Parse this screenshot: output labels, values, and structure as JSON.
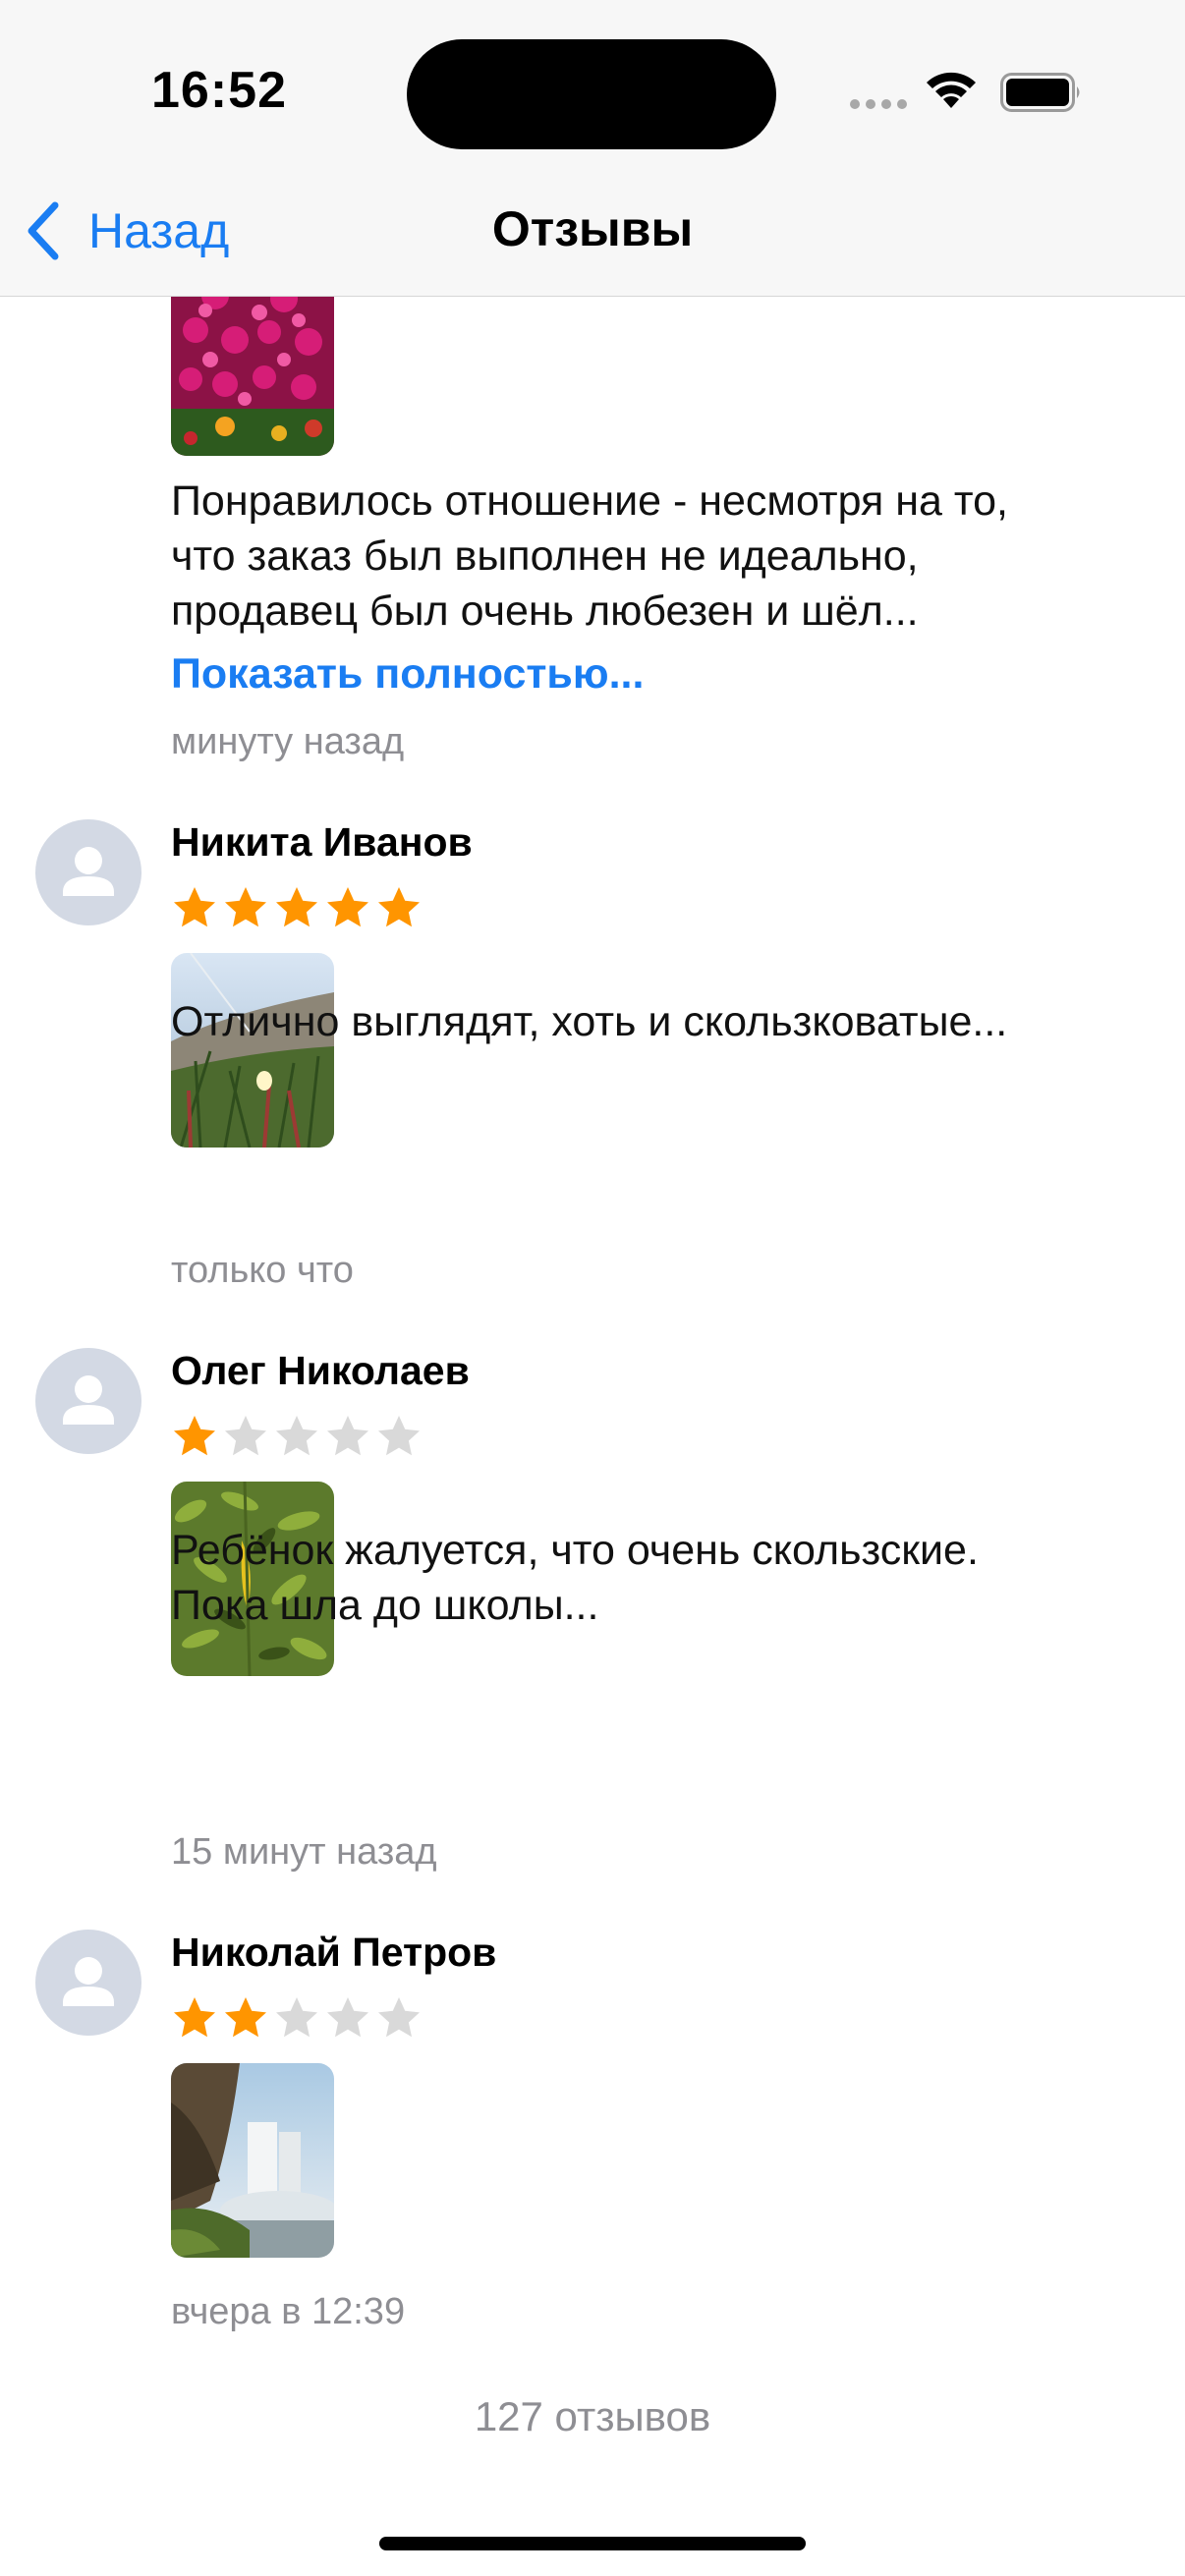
{
  "status_bar": {
    "time": "16:52"
  },
  "nav": {
    "back_label": "Назад",
    "title": "Отзывы"
  },
  "top_review": {
    "text_lines": [
      "Понравилось отношение - несмотря на то,",
      "что заказ был выполнен не идеально,",
      "продавец был очень любезен и шёл..."
    ],
    "show_more": "Показать полностью...",
    "time": "минуту назад"
  },
  "reviews": [
    {
      "author": "Никита Иванов",
      "rating": 5,
      "text_lines": [
        "Отлично выглядят, хоть и скользковатые..."
      ],
      "time": "только что"
    },
    {
      "author": "Олег Николаев",
      "rating": 1,
      "text_lines": [
        "Ребёнок жалуется, что очень скользские.",
        "Пока шла до школы..."
      ],
      "time": "15 минут назад"
    },
    {
      "author": "Николай Петров",
      "rating": 2,
      "text_lines": [],
      "time": "вчера в 12:39"
    }
  ],
  "footer": {
    "count": "127 отзывов"
  },
  "colors": {
    "accent": "#1a7df2",
    "star_filled": "#ff9500",
    "star_empty": "#d9d9d9",
    "secondary_text": "#8e8e93"
  }
}
